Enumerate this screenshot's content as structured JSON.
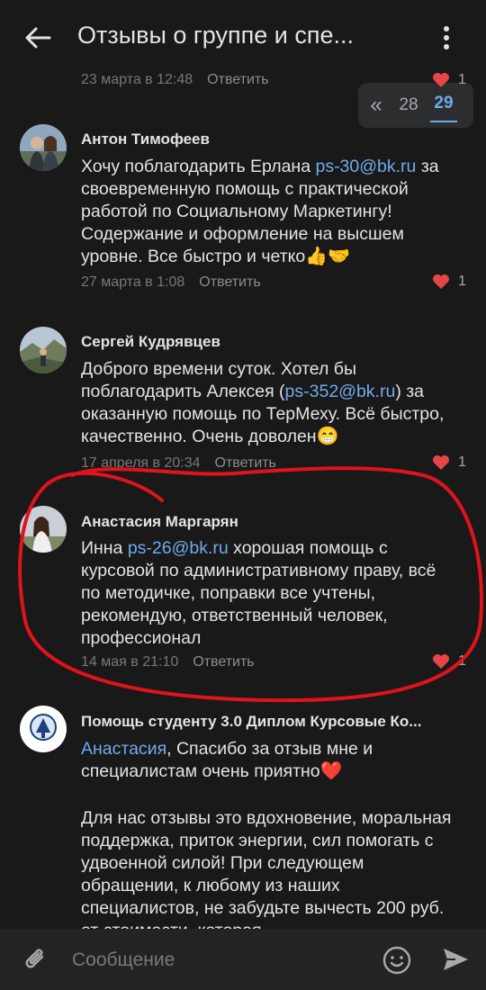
{
  "header": {
    "title": "Отзывы о группе и спе...",
    "back_icon": "arrow-left-icon",
    "menu_icon": "more-vertical-icon"
  },
  "pagination": {
    "first": "«",
    "pages": [
      "28",
      "29"
    ],
    "current": "29"
  },
  "colors": {
    "background": "#19191a",
    "link": "#71aaeb",
    "like_heart": "#e64646",
    "annotation": "#e0121c"
  },
  "comments": [
    {
      "date": "23 марта в 12:48",
      "reply": "Ответить",
      "likes": "1"
    },
    {
      "author": "Антон Тимофеев",
      "text_before": "Хочу поблагодарить Ерлана ",
      "link": "ps-30@bk.ru",
      "text_after": " за своевременную помощь с практической работой по Социальному Маркетингу! Содержание и оформление на высшем уровне. Все быстро и четко",
      "emojis": "👍🤝",
      "date": "27 марта в 1:08",
      "reply": "Ответить",
      "likes": "1"
    },
    {
      "author": "Сергей Кудрявцев",
      "text_before": "Доброго времени суток.  Хотел бы поблагодарить Алексея (",
      "link": "ps-352@bk.ru",
      "text_after": ") за  оказанную помощь по ТерМеху. Всё быстро, качественно.  Очень доволен",
      "emojis": "😁",
      "date": "17 апреля в 20:34",
      "reply": "Ответить",
      "likes": "1"
    },
    {
      "author": "Анастасия Маргарян",
      "text_before": "Инна ",
      "link": "ps-26@bk.ru",
      "text_after": " хорошая помощь с курсовой по административному праву, всё по методичке, поправки все учтены, рекомендую, ответственный человек, профессионал",
      "date": "14 мая в 21:10",
      "reply": "Ответить",
      "likes": "1"
    },
    {
      "author": "Помощь студенту 3.0 Диплом Курсовые Ко...",
      "mention": "Анастасия",
      "text_after": ", Спасибо за отзыв мне и специалистам очень приятно",
      "emojis": "❤️",
      "paragraph2": "Для нас отзывы это вдохновение, моральная поддержка, приток энергии, сил помогать с удвоенной силой! При следующем обращении, к любому из наших специалистов, не забудьте вычесть 200 руб. от стоимости, которая"
    }
  ],
  "composer": {
    "placeholder": "Сообщение",
    "attach_icon": "paperclip-icon",
    "emoji_icon": "smile-icon",
    "send_icon": "send-icon"
  }
}
